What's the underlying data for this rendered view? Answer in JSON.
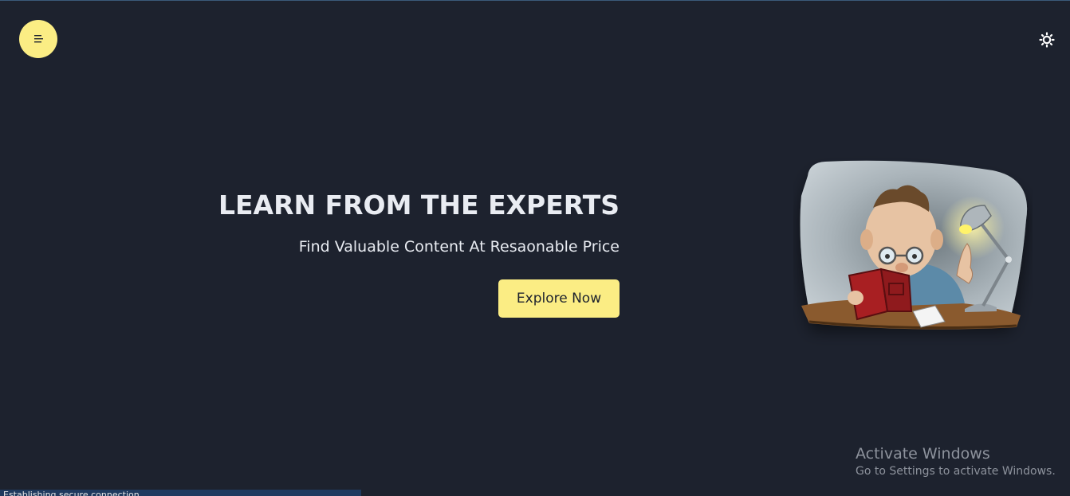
{
  "header": {
    "menu_icon": "menu-icon",
    "theme_icon": "sun-icon"
  },
  "hero": {
    "title": "LEARN FROM THE EXPERTS",
    "subtitle": "Find Valuable Content At Resaonable Price",
    "cta_label": "Explore Now"
  },
  "illustration": {
    "icon": "professor-reading-illustration"
  },
  "watermark": {
    "title": "Activate Windows",
    "subtitle": "Go to Settings to activate Windows."
  },
  "status_bar": {
    "text": "Establishing secure connection..."
  },
  "colors": {
    "background": "#1d222e",
    "accent": "#fbed84",
    "text": "#e9ecf2"
  }
}
